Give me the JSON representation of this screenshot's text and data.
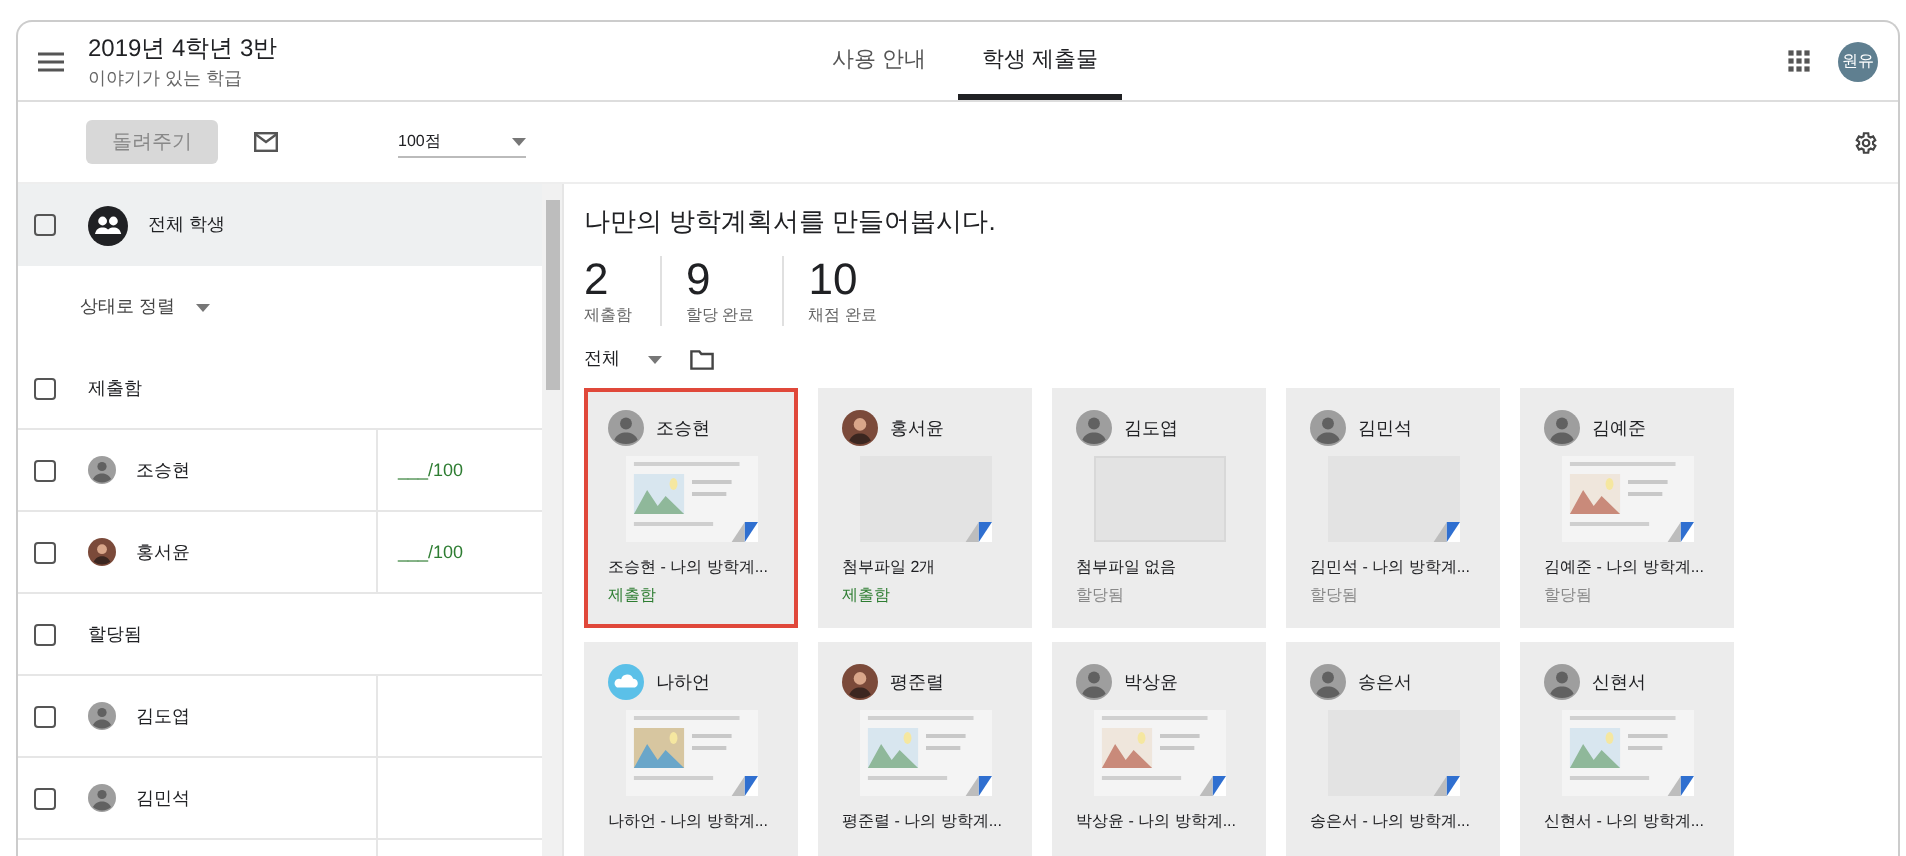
{
  "header": {
    "class_name": "2019년 4학년 3반",
    "class_subtitle": "이야기가 있는 학급",
    "tabs": [
      {
        "label": "사용 안내",
        "selected": false
      },
      {
        "label": "학생 제출물",
        "selected": true
      }
    ],
    "account_initials": "원유"
  },
  "toolbar": {
    "return_button": {
      "label": "돌려주기",
      "disabled": true
    },
    "points": "100점"
  },
  "student_list": {
    "all_students": {
      "label": "전체 학생",
      "checked": false
    },
    "sort": "상태로 정렬",
    "groups": [
      {
        "label": "제출함",
        "checked": false,
        "students": [
          {
            "name": "조승현",
            "avatar": {
              "kind": "default"
            },
            "score": "___/100",
            "checked": false
          },
          {
            "name": "홍서윤",
            "score": "___/100",
            "checked": false
          }
        ]
      },
      {
        "label": "할당됨",
        "checked": false,
        "students": [
          {
            "name": "김도엽",
            "avatar": {
              "kind": "default"
            },
            "checked": false
          },
          {
            "name": "김민석",
            "avatar": {
              "kind": "default"
            },
            "checked": false
          }
        ]
      }
    ]
  },
  "assignment": {
    "title": "나만의 방학계획서를 만들어봅시다.",
    "stats": [
      {
        "value": "2",
        "label": "제출함"
      },
      {
        "value": "9",
        "label": "할당 완료"
      },
      {
        "value": "10",
        "label": "채점 완료"
      }
    ],
    "filter": "전체",
    "cards": [
      {
        "name": "조승현",
        "avatar": {
          "kind": "default"
        },
        "thumbnail": {
          "kind": "doc"
        },
        "caption": "조승현 - 나의 방학계...",
        "status": {
          "text": "제출함",
          "kind": "turned_in"
        },
        "selected": true
      },
      {
        "name": "홍서윤",
        "thumbnail": {
          "kind": "blank"
        },
        "caption": "첨부파일 2개",
        "status": {
          "text": "제출함",
          "kind": "turned_in"
        },
        "selected": false
      },
      {
        "name": "김도엽",
        "avatar": {
          "kind": "default"
        },
        "thumbnail": {
          "kind": "none"
        },
        "caption": "첨부파일 없음",
        "status": {
          "text": "할당됨",
          "kind": "assigned"
        },
        "selected": false
      },
      {
        "name": "김민석",
        "avatar": {
          "kind": "default"
        },
        "thumbnail": {
          "kind": "blank"
        },
        "caption": "김민석 - 나의 방학계...",
        "status": {
          "text": "할당됨",
          "kind": "assigned"
        },
        "selected": false
      },
      {
        "name": "김예준",
        "avatar": {
          "kind": "default"
        },
        "thumbnail": {
          "kind": "doc"
        },
        "caption": "김예준 - 나의 방학계...",
        "status": {
          "text": "할당됨",
          "kind": "assigned"
        },
        "selected": false
      },
      {
        "name": "나하언",
        "avatar": {
          "kind": "cloud"
        },
        "thumbnail": {
          "kind": "doc"
        },
        "caption": "나하언 - 나의 방학계...",
        "selected": false
      },
      {
        "name": "평준렬",
        "thumbnail": {
          "kind": "doc"
        },
        "caption": "평준렬 - 나의 방학계...",
        "selected": false
      },
      {
        "name": "박상윤",
        "avatar": {
          "kind": "default"
        },
        "thumbnail": {
          "kind": "doc"
        },
        "caption": "박상윤 - 나의 방학계...",
        "selected": false
      },
      {
        "name": "송은서",
        "avatar": {
          "kind": "default"
        },
        "thumbnail": {
          "kind": "blank"
        },
        "caption": "송은서 - 나의 방학계...",
        "selected": false
      },
      {
        "name": "신현서",
        "avatar": {
          "kind": "default"
        },
        "thumbnail": {
          "kind": "doc"
        },
        "caption": "신현서 - 나의 방학계...",
        "selected": false
      }
    ]
  }
}
